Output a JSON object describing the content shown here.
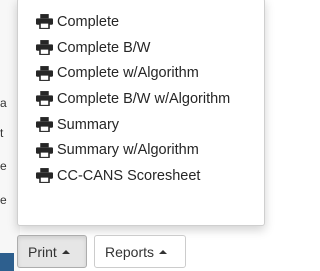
{
  "background": {
    "letters": [
      "a",
      "t",
      "e",
      "e"
    ]
  },
  "print_menu": {
    "items": [
      {
        "label": "Complete",
        "icon": "printer-icon"
      },
      {
        "label": "Complete B/W",
        "icon": "printer-icon"
      },
      {
        "label": "Complete w/Algorithm",
        "icon": "printer-icon"
      },
      {
        "label": "Complete B/W w/Algorithm",
        "icon": "printer-icon"
      },
      {
        "label": "Summary",
        "icon": "printer-icon"
      },
      {
        "label": "Summary w/Algorithm",
        "icon": "printer-icon"
      },
      {
        "label": "CC-CANS Scoresheet",
        "icon": "printer-icon"
      }
    ]
  },
  "toolbar": {
    "print_label": "Print",
    "reports_label": "Reports"
  },
  "colors": {
    "accent": "#2d5f8e",
    "text": "#262626",
    "border": "#cccccc"
  }
}
